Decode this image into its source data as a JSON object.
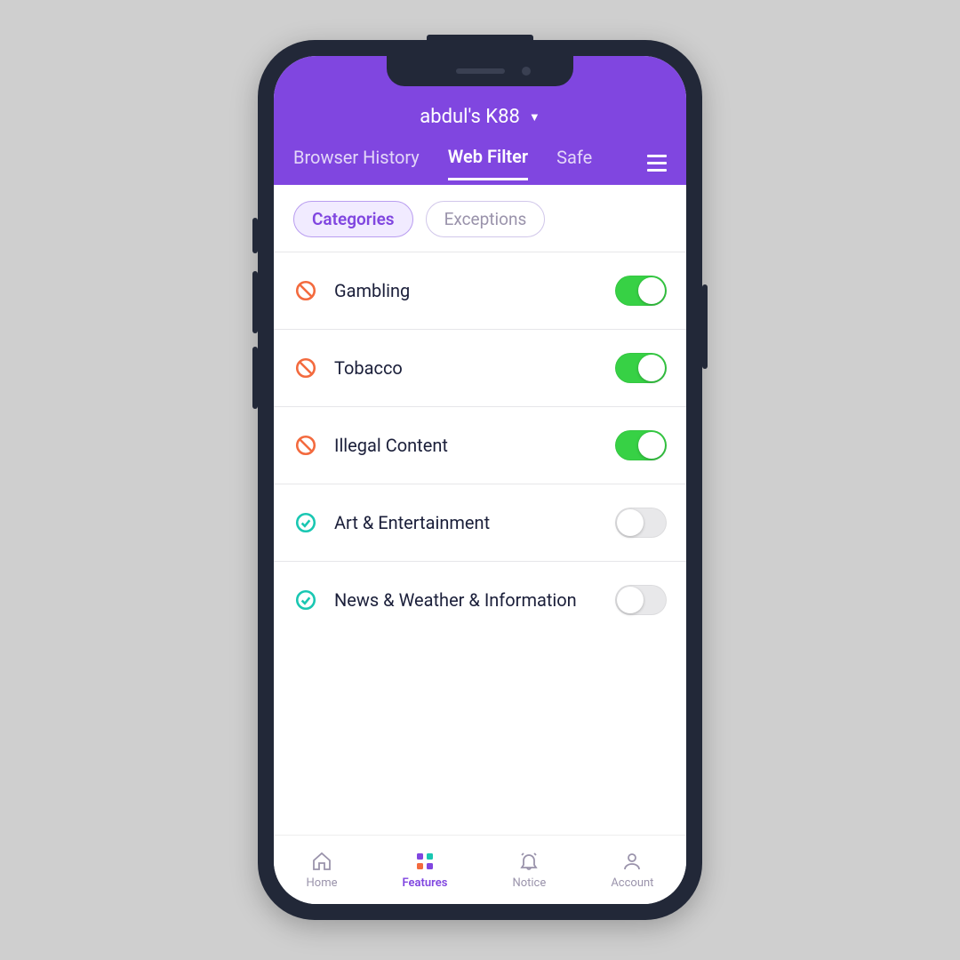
{
  "header": {
    "device": "abdul's K88",
    "tabs": [
      "Browser History",
      "Web Filter",
      "Safe"
    ],
    "active_tab": "Web Filter"
  },
  "filter_tabs": {
    "items": [
      "Categories",
      "Exceptions"
    ],
    "active": "Categories"
  },
  "categories": [
    {
      "label": "Gambling",
      "blocked": true,
      "enabled": true
    },
    {
      "label": "Tobacco",
      "blocked": true,
      "enabled": true
    },
    {
      "label": "Illegal Content",
      "blocked": true,
      "enabled": true
    },
    {
      "label": "Art & Entertainment",
      "blocked": false,
      "enabled": false
    },
    {
      "label": "News & Weather & Information",
      "blocked": false,
      "enabled": false
    }
  ],
  "bottom_nav": {
    "items": [
      "Home",
      "Features",
      "Notice",
      "Account"
    ],
    "active": "Features"
  },
  "colors": {
    "accent": "#8046e0",
    "toggle_on": "#37d145",
    "block_icon": "#f36a3e",
    "allow_icon": "#19c7b2"
  }
}
